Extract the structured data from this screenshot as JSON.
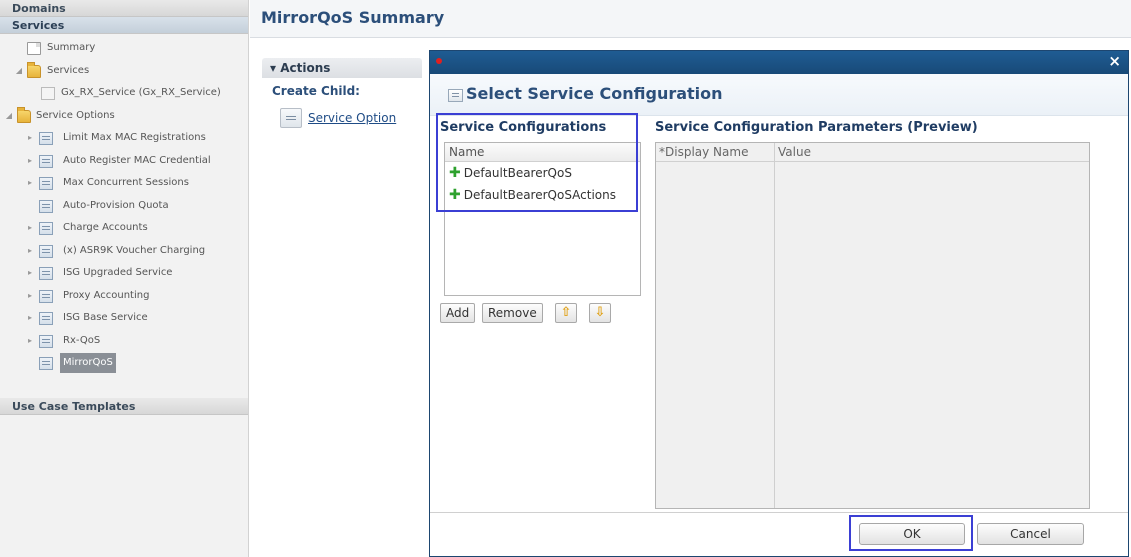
{
  "sidebar": {
    "domains_label": "Domains",
    "services_label": "Services",
    "use_case_label": "Use Case Templates",
    "tree": [
      {
        "label": "Summary"
      },
      {
        "label": "Services"
      },
      {
        "label": "Gx_RX_Service (Gx_RX_Service)"
      },
      {
        "label": "Service Options"
      },
      {
        "label": "Limit Max MAC Registrations"
      },
      {
        "label": "Auto Register MAC Credential"
      },
      {
        "label": "Max Concurrent Sessions"
      },
      {
        "label": "Auto-Provision Quota"
      },
      {
        "label": "Charge Accounts"
      },
      {
        "label": "(x) ASR9K Voucher Charging"
      },
      {
        "label": "ISG Upgraded Service"
      },
      {
        "label": "Proxy Accounting"
      },
      {
        "label": "ISG Base Service"
      },
      {
        "label": "Rx-QoS"
      },
      {
        "label": "MirrorQoS"
      }
    ]
  },
  "main": {
    "title": "MirrorQoS Summary",
    "actions_label": "▾ Actions",
    "create_child_label": "Create Child:",
    "service_option_label": "Service Option"
  },
  "dialog": {
    "close_glyph": "×",
    "title": "Select Service Configuration",
    "configs_title": "Service Configurations",
    "configs_column": "Name",
    "configs": [
      "DefaultBearerQoS",
      "DefaultBearerQoSActions"
    ],
    "add_label": "Add",
    "remove_label": "Remove",
    "up_glyph": "⇧",
    "down_glyph": "⇩",
    "params_title": "Service Configuration Parameters (Preview)",
    "params_col1": "*Display Name",
    "params_col2": "Value",
    "ok_label": "OK",
    "cancel_label": "Cancel"
  }
}
